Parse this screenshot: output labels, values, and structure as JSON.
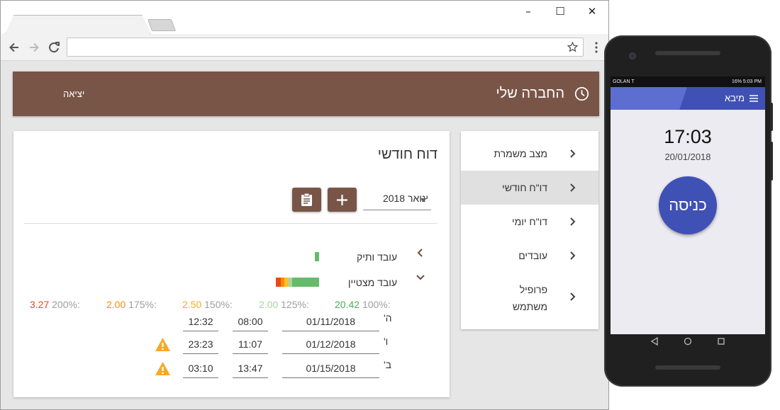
{
  "browser": {
    "window_controls": [
      "–",
      "☐",
      "✕"
    ],
    "address": ""
  },
  "app": {
    "title": "החברה שלי",
    "logout": "יציאה",
    "accent_color": "#795548"
  },
  "menu": {
    "items": [
      {
        "label": "מצב משמרת",
        "active": false
      },
      {
        "label": "דו\"ח חודשי",
        "active": true
      },
      {
        "label": "דו\"ח יומי",
        "active": false
      },
      {
        "label": "עובדים",
        "active": false
      },
      {
        "label": "פרופיל משתמש",
        "active": false
      }
    ]
  },
  "report": {
    "title": "דוח חודשי",
    "month": "ינואר 2018",
    "employees": [
      {
        "name": "עובד ותיק"
      },
      {
        "name": "עובד מצטיין"
      }
    ],
    "stats": [
      {
        "label": "100%:",
        "value": "20.42",
        "color": "#4caf50"
      },
      {
        "label": "125%:",
        "value": "2.00",
        "color": "#a5d6a7"
      },
      {
        "label": "150%:",
        "value": "2.50",
        "color": "#f9a825"
      },
      {
        "label": "175%:",
        "value": "2.00",
        "color": "#fb8c00"
      },
      {
        "label": "200%:",
        "value": "3.27",
        "color": "#e64a19"
      }
    ],
    "shifts": [
      {
        "day": "ה'",
        "date": "01/11/2018",
        "start": "08:00",
        "end": "12:32",
        "warning": false
      },
      {
        "day": "ו'",
        "date": "01/12/2018",
        "start": "11:07",
        "end": "23:23",
        "warning": true
      },
      {
        "day": "ב'",
        "date": "01/15/2018",
        "start": "13:47",
        "end": "03:10",
        "warning": true
      }
    ]
  },
  "phone": {
    "carrier": "GOLAN T",
    "status": "16% 5:03 PM",
    "app_title": "מיבא",
    "time": "17:03",
    "date": "20/01/2018",
    "checkin_label": "כניסה",
    "accent_color": "#3f51b5"
  }
}
